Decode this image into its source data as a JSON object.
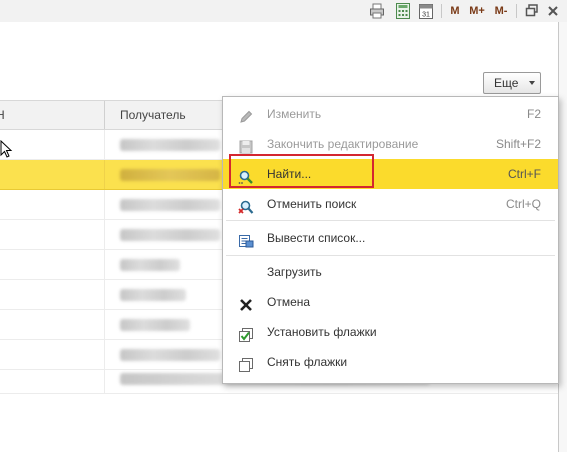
{
  "toolbar": {
    "memory_m": "M",
    "memory_plus": "M+",
    "memory_minus": "M-"
  },
  "more_button": {
    "label": "Еще"
  },
  "table": {
    "columns": [
      "Н",
      "Получатель"
    ]
  },
  "menu": {
    "items": [
      {
        "label": "Изменить",
        "shortcut": "F2",
        "icon": "pencil-icon",
        "enabled": false
      },
      {
        "label": "Закончить редактирование",
        "shortcut": "Shift+F2",
        "icon": "save-icon",
        "enabled": false
      },
      {
        "label": "Найти...",
        "shortcut": "Ctrl+F",
        "icon": "search-icon",
        "enabled": true,
        "highlighted": true
      },
      {
        "label": "Отменить поиск",
        "shortcut": "Ctrl+Q",
        "icon": "cancel-search-icon",
        "enabled": true
      },
      {
        "label": "Вывести список...",
        "shortcut": "",
        "icon": "print-list-icon",
        "enabled": true
      },
      {
        "label": "Загрузить",
        "shortcut": "",
        "icon": "",
        "enabled": true
      },
      {
        "label": "Отмена",
        "shortcut": "",
        "icon": "close-icon",
        "enabled": true
      },
      {
        "label": "Установить флажки",
        "shortcut": "",
        "icon": "check-all-icon",
        "enabled": true
      },
      {
        "label": "Снять флажки",
        "shortcut": "",
        "icon": "uncheck-all-icon",
        "enabled": true
      }
    ]
  },
  "colors": {
    "highlight": "#fbdb2c",
    "selected_row": "#fbe14e",
    "annotation_box": "#d4272f"
  }
}
